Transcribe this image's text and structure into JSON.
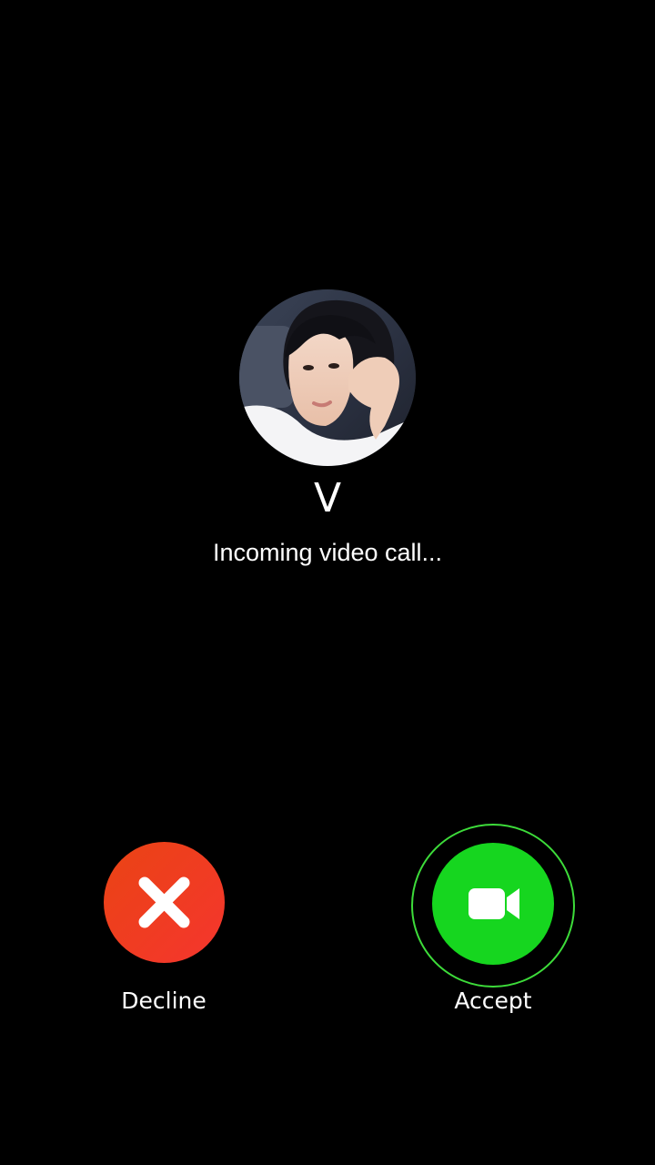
{
  "caller": {
    "name": "V",
    "status": "Incoming video call..."
  },
  "actions": {
    "decline": {
      "label": "Decline",
      "icon": "close-icon",
      "color": "#ef3a22"
    },
    "accept": {
      "label": "Accept",
      "icon": "video-camera-icon",
      "color": "#16d61f",
      "ring_color": "#3ddc3a"
    }
  },
  "colors": {
    "background": "#000000",
    "text": "#ffffff"
  }
}
